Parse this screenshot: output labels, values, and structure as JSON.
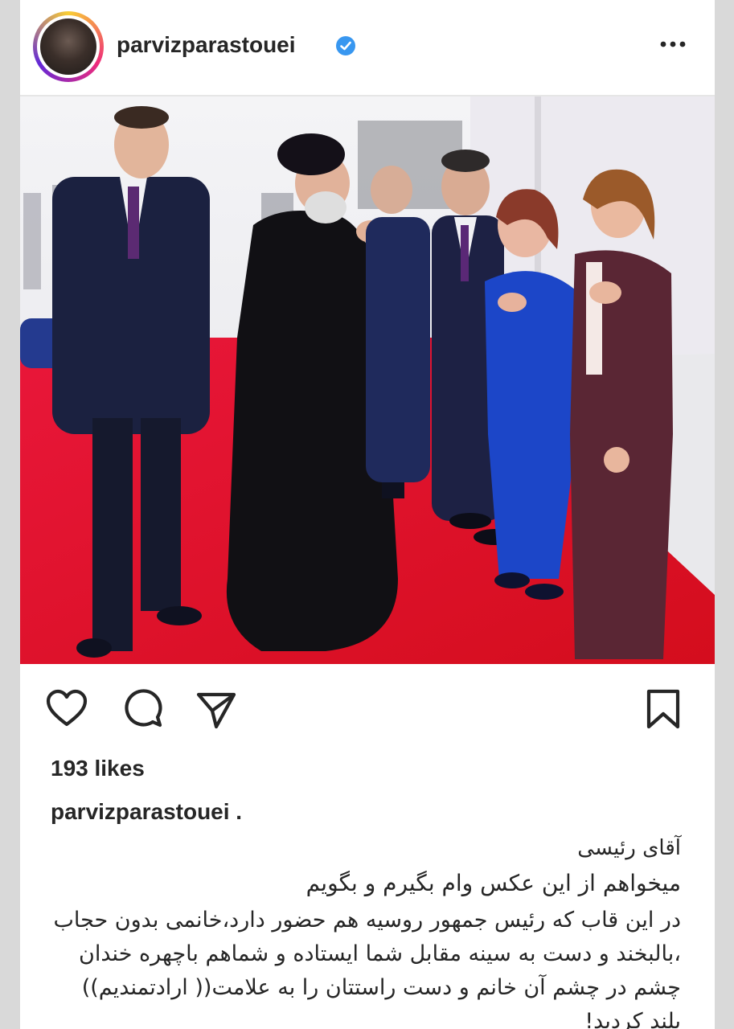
{
  "post": {
    "username": "parvizparastouei",
    "verified_icon": "verified-badge-icon",
    "more_icon": "more-horizontal-icon",
    "likes": "193 likes",
    "caption_user": "parvizparastouei .",
    "caption_line1": "آقای رئیسی",
    "caption_line2": "میخواهم از این عکس وام بگیرم و بگویم",
    "caption_body": "در این قاب که رئیس جمهور روسیه هم حضور دارد،خانمی بدون حجاب ،بالبخند و دست به سینه مقابل شما ایستاده و شماهم باچهره خندان چشم در چشم آن خانم و دست راستتان را به علامت(( ارادتمندیم)) بلند کردید!"
  },
  "actions": {
    "like_icon": "heart-icon",
    "comment_icon": "comment-icon",
    "share_icon": "send-icon",
    "save_icon": "bookmark-icon"
  },
  "colors": {
    "verified": "#3897f0",
    "text": "#262626",
    "carpet": "#e5112a"
  }
}
